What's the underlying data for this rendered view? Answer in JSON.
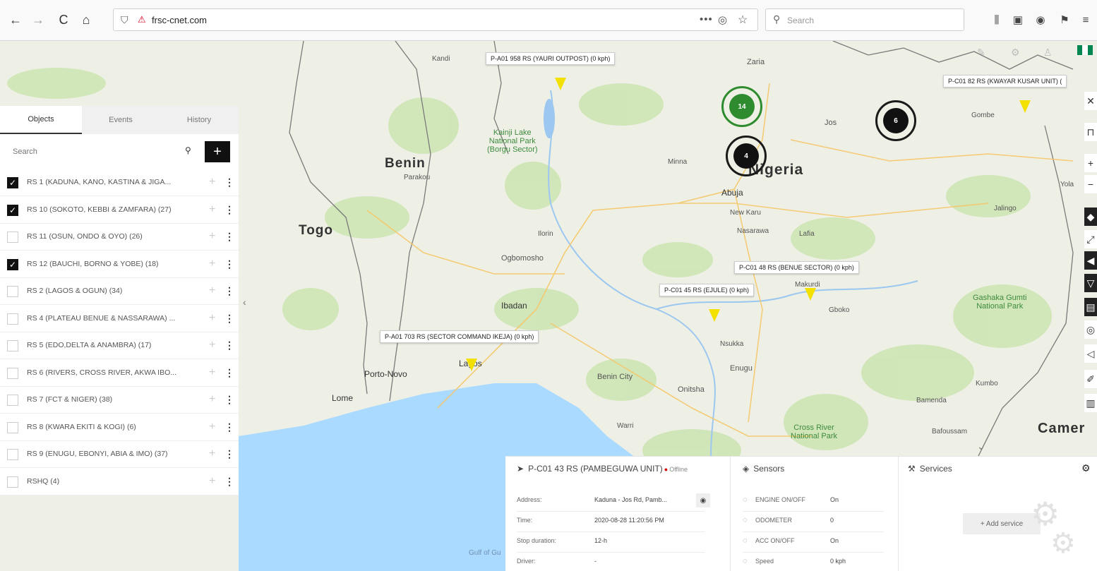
{
  "browser": {
    "url": "frsc-cnet.com",
    "search_placeholder": "Search",
    "nav": {
      "back": "←",
      "forward": "→",
      "reload": "C",
      "home": "⌂"
    },
    "icons": [
      "shield-icon",
      "lock-icon",
      "more-icon",
      "pocket-icon",
      "star-icon",
      "library-icon",
      "sidebar-icon",
      "account-icon",
      "gift-icon",
      "menu-icon"
    ]
  },
  "panel": {
    "tabs": [
      "Objects",
      "Events",
      "History"
    ],
    "search_placeholder": "Search",
    "add_label": "+",
    "groups": [
      {
        "label": "RS 1 (KADUNA, KANO, KASTINA & JIGA...",
        "checked": true
      },
      {
        "label": "RS 10 (SOKOTO, KEBBI & ZAMFARA) (27)",
        "checked": true
      },
      {
        "label": "RS 11 (OSUN, ONDO & OYO) (26)",
        "checked": false
      },
      {
        "label": "RS 12 (BAUCHI, BORNO & YOBE) (18)",
        "checked": true
      },
      {
        "label": "RS 2 (LAGOS & OGUN) (34)",
        "checked": false
      },
      {
        "label": "RS 4 (PLATEAU BENUE & NASSARAWA) ...",
        "checked": false
      },
      {
        "label": "RS 5 (EDO,DELTA & ANAMBRA) (17)",
        "checked": false
      },
      {
        "label": "RS 6 (RIVERS, CROSS RIVER, AKWA IBO...",
        "checked": false
      },
      {
        "label": "RS 7 (FCT & NIGER) (38)",
        "checked": false
      },
      {
        "label": "RS 8 (KWARA EKITI & KOGI) (6)",
        "checked": false
      },
      {
        "label": "RS 9 (ENUGU, EBONYI, ABIA & IMO) (37)",
        "checked": false
      },
      {
        "label": "RSHQ (4)",
        "checked": false
      }
    ]
  },
  "map": {
    "countries": {
      "benin": "Benin",
      "togo": "Togo",
      "nigeria": "Nigeria",
      "cameroon": "Camer"
    },
    "cities": {
      "abuja": "Abuja",
      "ibadan": "Ibadan",
      "lagos": "Lagos",
      "porto_novo": "Porto-Novo",
      "lome": "Lome",
      "zaria": "Zaria",
      "jos": "Jos",
      "minna": "Minna",
      "ilorin": "Ilorin",
      "ogbomosho": "Ogbomosho",
      "parakou": "Parakou",
      "benin_city": "Benin City",
      "onitsha": "Onitsha",
      "enugu": "Enugu",
      "makurdi": "Makurdi",
      "lafia": "Lafia",
      "nsukka": "Nsukka",
      "gboko": "Gboko",
      "gombe": "Gombe",
      "jalingo": "Jalingo",
      "bamenda": "Bamenda",
      "kumbo": "Kumbo",
      "bafoussam": "Bafoussam",
      "warri": "Warri",
      "nasarawa": "Nasarawa",
      "new_karu": "New Karu",
      "yola": "Yola",
      "kano_town": "Kandi"
    },
    "parks": {
      "kainji": "Kainji Lake\nNational Park\n(Borgu Sector)",
      "gashaka": "Gashaka Gumti\nNational Park",
      "cross_river": "Cross River\nNational Park"
    },
    "vehicle_labels": [
      "P-A01 958 RS (YAURI OUTPOST) (0 kph)",
      "P-C01 82 RS (KWAYAR KUSAR UNIT) (",
      "P-C01 48 RS (BENUE SECTOR) (0 kph)",
      "P-C01 45 RS (EJULE) (0 kph)",
      "P-A01 703 RS (SECTOR COMMAND IKEJA) (0 kph)"
    ],
    "clusters": [
      {
        "count": "14",
        "color": "#2e8b2e"
      },
      {
        "count": "4",
        "color": "#111111"
      },
      {
        "count": "6",
        "color": "#111111"
      }
    ],
    "gulf_label": "Gulf of Gu",
    "flag_colors": [
      "#008751",
      "#ffffff",
      "#008751"
    ]
  },
  "vehicle": {
    "name": "P-C01 43 RS (PAMBEGUWA UNIT)",
    "status": "Offline",
    "fields": [
      {
        "key": "Address:",
        "value": "Kaduna - Jos Rd, Pamb..."
      },
      {
        "key": "Time:",
        "value": "2020-08-28 11:20:56 PM"
      },
      {
        "key": "Stop duration:",
        "value": "12-h"
      },
      {
        "key": "Driver:",
        "value": "-"
      }
    ]
  },
  "sensors": {
    "title": "Sensors",
    "items": [
      {
        "name": "ENGINE ON/OFF",
        "value": "On"
      },
      {
        "name": "ODOMETER",
        "value": "0"
      },
      {
        "name": "ACC ON/OFF",
        "value": "On"
      },
      {
        "name": "Speed",
        "value": "0 kph"
      }
    ]
  },
  "services": {
    "title": "Services",
    "add_label": "+ Add service"
  }
}
